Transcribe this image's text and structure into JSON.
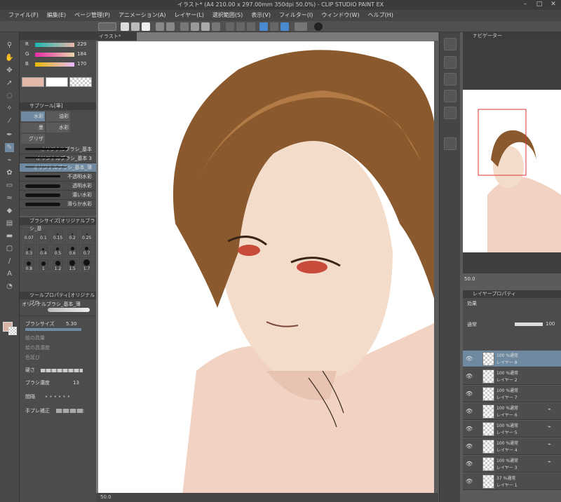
{
  "window": {
    "title": "イラスト* (A4 210.00 x 297.00mm 350dpi 50.0%)  - CLIP STUDIO PAINT EX"
  },
  "menu": [
    "ファイル(F)",
    "編集(E)",
    "ページ管理(P)",
    "アニメーション(A)",
    "レイヤー(L)",
    "選択範囲(S)",
    "表示(V)",
    "フィルター(I)",
    "ウィンドウ(W)",
    "ヘルプ(H)"
  ],
  "canvas": {
    "tab_label": "イラスト*",
    "zoom": "50.0"
  },
  "color": {
    "r_label": "R",
    "g_label": "G",
    "b_label": "B",
    "r": "229",
    "g": "184",
    "b": "170",
    "current": "#d6b3a5"
  },
  "subtool": {
    "header": "サブツール[筆]",
    "tabs": [
      "水彩",
      "油彩",
      "墨",
      "水彩",
      "グリザ"
    ],
    "brushes": [
      {
        "label": "オリジナルブラシ_基本",
        "selected": false
      },
      {
        "label": "オリジナルブラシ_基本 3",
        "selected": false
      },
      {
        "label": "オリジナルブラシ_基本_薄",
        "selected": true
      },
      {
        "label": "不透明水彩",
        "selected": false
      },
      {
        "label": "透明水彩",
        "selected": false
      },
      {
        "label": "濃い水彩",
        "selected": false
      },
      {
        "label": "滑らか水彩",
        "selected": false
      }
    ]
  },
  "brush_size": {
    "header": "ブラシサイズ[オリジナルブラシ_基",
    "sizes": [
      "0.07",
      "0.1",
      "0.15",
      "0.2",
      "0.25",
      "0.3",
      "0.4",
      "0.5",
      "0.6",
      "0.7",
      "0.8",
      "1",
      "1.2",
      "1.5",
      "1.7"
    ]
  },
  "tool_property": {
    "header": "ツールプロパティ[オリジナルブラ",
    "brush_name": "オリジナルブラシ_基本_薄",
    "brush_size_label": "ブラシサイズ",
    "brush_size_value": "5.30",
    "paint_amount_label": "絵の具量",
    "paint_density_label": "絵の具濃度",
    "color_stretch_label": "色延び",
    "blur_label": "硬さ",
    "brush_density_label": "ブラシ濃度",
    "brush_density_value": "13",
    "interval_label": "間隔",
    "stabilization_label": "手ブレ補正"
  },
  "navigator": {
    "header": "ナビゲーター",
    "zoom": "50.0"
  },
  "layer_property": {
    "header": "レイヤープロパティ",
    "effect_label": "効果"
  },
  "layers": {
    "blend_mode": "通常",
    "opacity": "100",
    "items": [
      {
        "line1": "100 %通常",
        "line2": "レイヤー 8",
        "selected": true
      },
      {
        "line1": "100 %通常",
        "line2": "レイヤー 2",
        "selected": false
      },
      {
        "line1": "100 %通常",
        "line2": "レイヤー 7",
        "selected": false
      },
      {
        "line1": "100 %通常",
        "line2": "レイヤー 6",
        "selected": false
      },
      {
        "line1": "100 %通常",
        "line2": "レイヤー 5",
        "selected": false
      },
      {
        "line1": "100 %通常",
        "line2": "レイヤー 4",
        "selected": false
      },
      {
        "line1": "100 %通常",
        "line2": "レイヤー 3",
        "selected": false
      },
      {
        "line1": "37 %通常",
        "line2": "レイヤー 1",
        "selected": false
      }
    ]
  }
}
